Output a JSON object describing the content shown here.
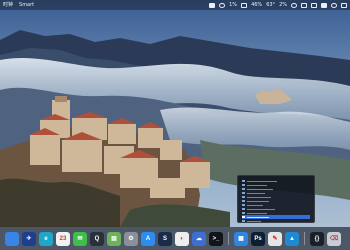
{
  "menubar": {
    "app_name": "时钟",
    "menu_item": "Smart",
    "status_text_1": "1%",
    "status_text_2": "46%",
    "status_text_3": "63°",
    "status_text_4": "2%"
  },
  "dock": {
    "apps": [
      {
        "name": "finder-icon",
        "color": "#3a84e6",
        "label": ""
      },
      {
        "name": "launchpad-icon",
        "color": "#1e3f8f",
        "label": "✈"
      },
      {
        "name": "edge-icon",
        "color": "#1fa6c9",
        "label": "e"
      },
      {
        "name": "calendar-icon",
        "color": "#f2f2f2",
        "label": "23"
      },
      {
        "name": "wechat-icon",
        "color": "#3fbf4a",
        "label": "✉"
      },
      {
        "name": "qq-icon",
        "color": "#2a2f3a",
        "label": "Q"
      },
      {
        "name": "image-app-icon",
        "color": "#6db25a",
        "label": "▤"
      },
      {
        "name": "settings-icon",
        "color": "#8a8f99",
        "label": "⚙"
      },
      {
        "name": "appstore-icon",
        "color": "#2a8df2",
        "label": "A"
      },
      {
        "name": "steam-icon",
        "color": "#1a2c4a",
        "label": "S"
      },
      {
        "name": "compass-icon",
        "color": "#eeeeee",
        "label": "◐"
      },
      {
        "name": "weather-icon",
        "color": "#3d6fd0",
        "label": "☁"
      },
      {
        "name": "terminal-icon",
        "color": "#111418",
        "label": ">_"
      },
      {
        "name": "windows-icon",
        "color": "#2f86e0",
        "label": "▦"
      },
      {
        "name": "photoshop-icon",
        "color": "#0b1f33",
        "label": "Ps"
      },
      {
        "name": "notes-app-icon",
        "color": "#e6e6e6",
        "label": "✎"
      },
      {
        "name": "azure-icon",
        "color": "#1e8ad6",
        "label": "▲"
      },
      {
        "name": "code-icon",
        "color": "#1b1f29",
        "label": "{}"
      },
      {
        "name": "trash-icon",
        "color": "#c9ced6",
        "label": "⌫"
      }
    ]
  },
  "colors": {
    "sky": "#4a6ea0",
    "dock_bg": "#262c3a",
    "menubar_bg": "#141822"
  }
}
